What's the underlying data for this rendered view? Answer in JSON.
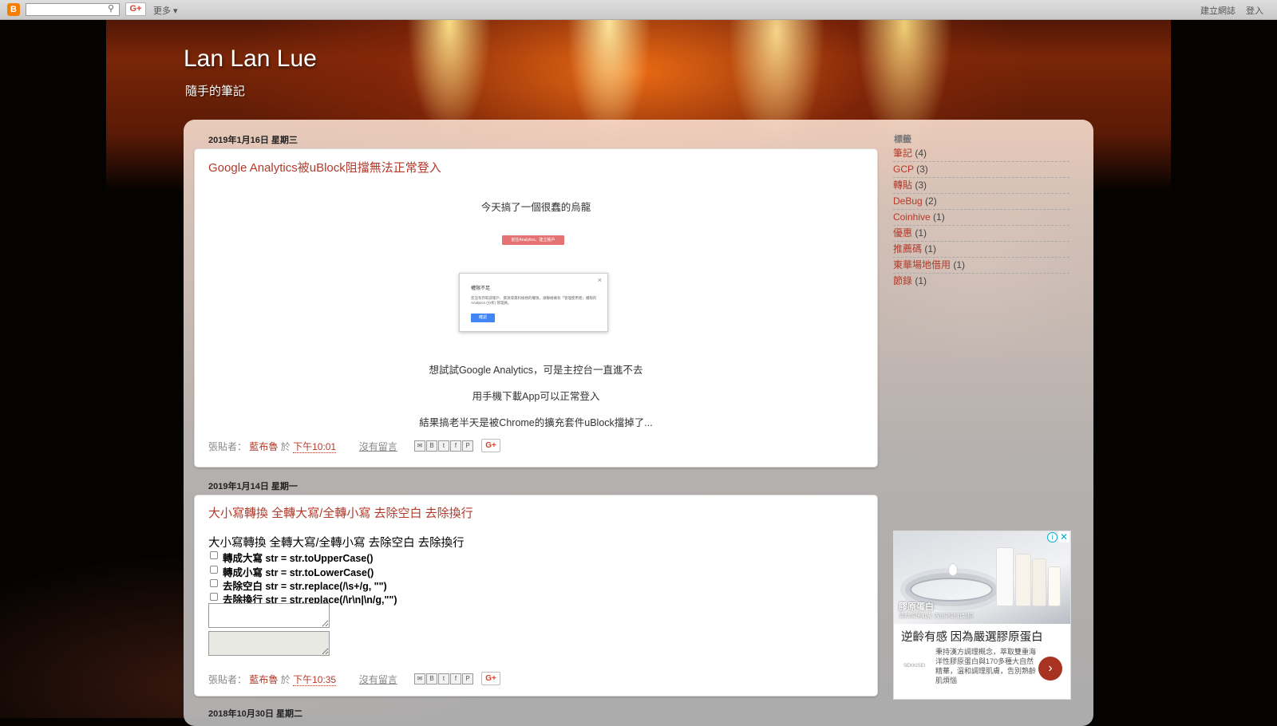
{
  "navbar": {
    "search_placeholder": "",
    "gplus": "G+",
    "more": "更多 ▾",
    "create_blog": "建立網誌",
    "login": "登入"
  },
  "header": {
    "title": "Lan Lan Lue",
    "description": "隨手的筆記"
  },
  "posts": [
    {
      "date": "2019年1月16日 星期三",
      "title": "Google Analytics被uBlock阻擋無法正常登入",
      "lines": [
        "今天搞了一個很蠢的烏龍",
        "想試試Google Analytics，可是主控台一直進不去",
        "用手機下載App可以正常登入",
        "結果搞老半天是被Chrome的擴充套件uBlock擋掉了..."
      ],
      "embedded_dialog": {
        "button": "前往Analytics，建立帳戶",
        "title": "權限不足",
        "body": "您沒有存取該帳戶、資源或資料檢視的權限，請聯絡擁有「管理使用者」權限的 Analytics (分析) 管理員。",
        "ok": "確認",
        "close": "×"
      },
      "footer": {
        "posted_by": "張貼者：",
        "author": "藍布魯",
        "at": "於",
        "time": "下午10:01",
        "comments": "沒有留言"
      }
    },
    {
      "date": "2019年1月14日 星期一",
      "title": "大小寫轉換 全轉大寫/全轉小寫 去除空白 去除換行",
      "heading": "大小寫轉換 全轉大寫/全轉小寫 去除空白 去除換行",
      "options": [
        "轉成大寫 str = str.toUpperCase()",
        "轉成小寫 str = str.toLowerCase()",
        "去除空白 str = str.replace(/\\s+/g, \"\")",
        "去除換行 str = str.replace(/\\r\\n|\\n/g,\"\")"
      ],
      "footer": {
        "posted_by": "張貼者：",
        "author": "藍布魯",
        "at": "於",
        "time": "下午10:35",
        "comments": "沒有留言"
      }
    },
    {
      "date": "2018年10月30日 星期二"
    }
  ],
  "share_icons": [
    "email-icon",
    "blog-this-icon",
    "twitter-icon",
    "facebook-icon",
    "pinterest-icon"
  ],
  "sidebar": {
    "heading": "標籤",
    "labels": [
      {
        "name": "筆記",
        "count": "(4)"
      },
      {
        "name": "GCP",
        "count": "(3)"
      },
      {
        "name": "轉貼",
        "count": "(3)"
      },
      {
        "name": "DeBug",
        "count": "(2)"
      },
      {
        "name": "Coinhive",
        "count": "(1)"
      },
      {
        "name": "優惠",
        "count": "(1)"
      },
      {
        "name": "推薦碼",
        "count": "(1)"
      },
      {
        "name": "東華場地借用",
        "count": "(1)"
      },
      {
        "name": "節錄",
        "count": "(1)"
      }
    ]
  },
  "ad": {
    "image_tag": "膠原蛋白",
    "image_sub": "溫和調理肌膚 告別熟齡肌新招",
    "headline": "逆齡有感 因為嚴選膠原蛋白",
    "brand": "SEKKISEI",
    "body": "秉持漢方調理概念，萃取雙重海洋性膠原蛋白與170多種大自然精華，溫和調理肌膚，告別熟齡肌煩惱"
  },
  "colors": {
    "accent": "#b33a2a",
    "ad_arrow": "#a83322"
  }
}
